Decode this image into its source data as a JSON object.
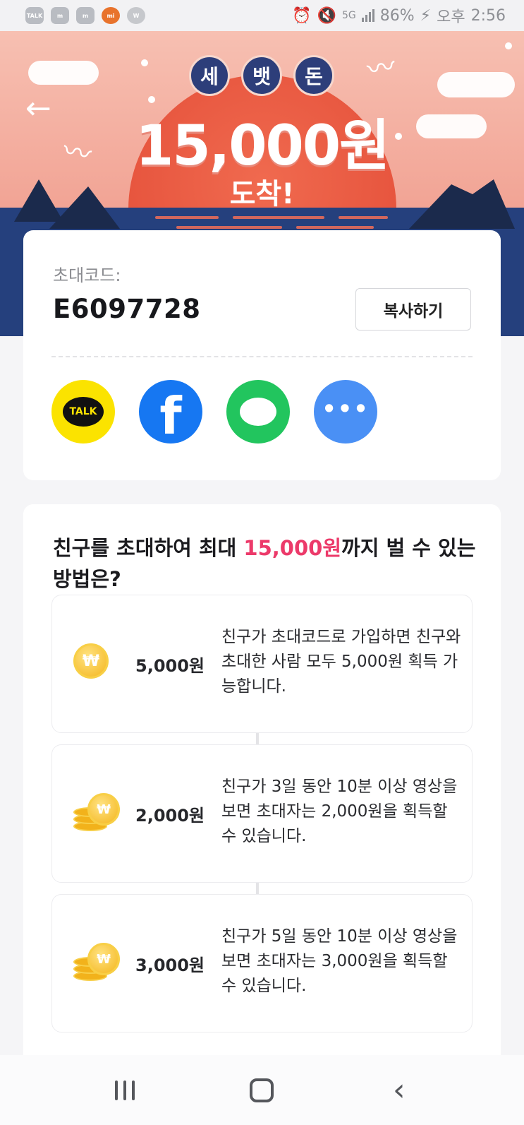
{
  "status_bar": {
    "apps": [
      "TALK",
      "m",
      "m",
      "mi",
      "W"
    ],
    "network": "5G",
    "battery": "86%",
    "ampm": "오후",
    "time": "2:56"
  },
  "hero": {
    "pills": [
      "세",
      "뱃",
      "돈"
    ],
    "amount": "15,000원",
    "arrive": "도착!",
    "back_icon": "arrow-left-icon"
  },
  "invite": {
    "code_label": "초대코드:",
    "code_value": "E6097728",
    "copy_label": "복사하기",
    "share": [
      {
        "name": "kakaotalk",
        "label": "TALK"
      },
      {
        "name": "facebook",
        "label": "f"
      },
      {
        "name": "line",
        "label": ""
      },
      {
        "name": "more",
        "label": "•••"
      }
    ]
  },
  "how": {
    "title_pre": "친구를 초대하여 최대 ",
    "title_highlight": "15,000원",
    "title_post": "까지 벌 수 있는 방법은?",
    "steps": [
      {
        "amount": "5,000원",
        "desc": "친구가 초대코드로 가입하면 친구와 초대한 사람 모두 5,000원 획득 가능합니다.",
        "icon": "coin-icon"
      },
      {
        "amount": "2,000원",
        "desc": "친구가 3일 동안 10분 이상 영상을 보면 초대자는 2,000원을 획득할 수 있습니다.",
        "icon": "coin-stack-icon"
      },
      {
        "amount": "3,000원",
        "desc": "친구가 5일 동안 10분 이상 영상을 보면 초대자는 3,000원을 획득할 수 있습니다.",
        "icon": "coin-stack-icon"
      }
    ],
    "coin_symbol": "₩"
  },
  "colors": {
    "accent_pink": "#ec3a6a",
    "sea": "#223a73",
    "kakao": "#fbe300",
    "facebook": "#1677f2",
    "line": "#22c55e",
    "more": "#4a90f5"
  }
}
